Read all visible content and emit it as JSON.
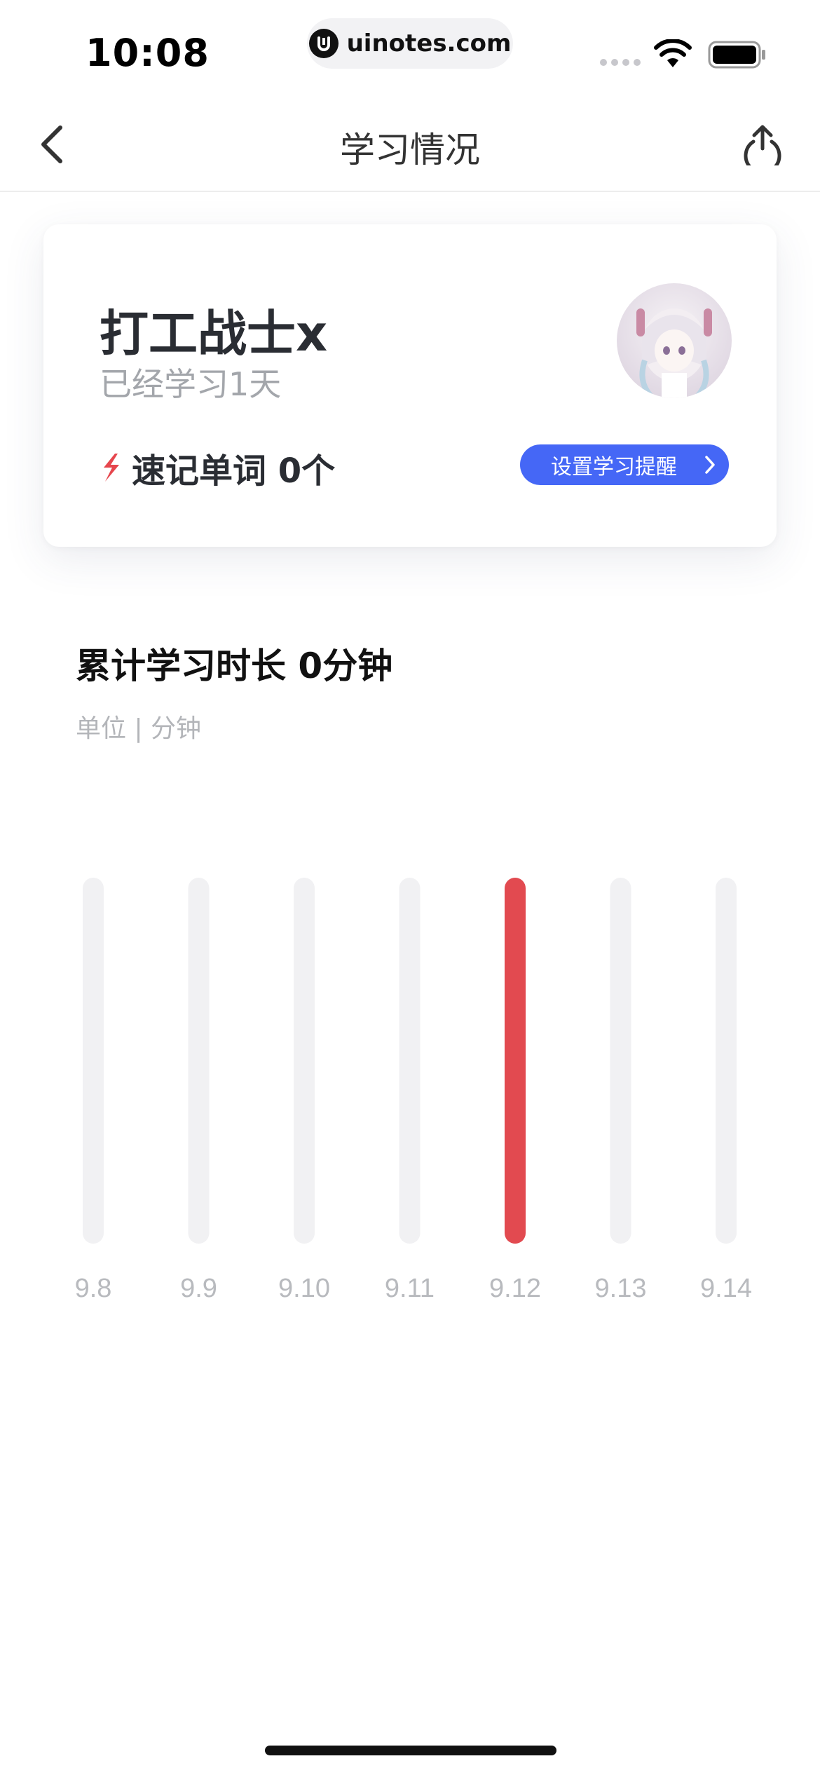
{
  "status_bar": {
    "time": "10:08",
    "url": "uinotes.com"
  },
  "nav": {
    "title": "学习情况",
    "back_icon": "chevron-left-icon",
    "share_icon": "share-icon"
  },
  "profile": {
    "name": "打工战士x",
    "days_studied": "已经学习1天",
    "words_label": "速记单词 0个",
    "reminder_button": "设置学习提醒",
    "accent_color": "#e6464d",
    "button_color": "#4567f6"
  },
  "chart_section": {
    "title": "累计学习时长 0分钟",
    "unit": "单位 | 分钟"
  },
  "chart_data": {
    "type": "bar",
    "categories": [
      "9.8",
      "9.9",
      "9.10",
      "9.11",
      "9.12",
      "9.13",
      "9.14"
    ],
    "values": [
      0,
      0,
      0,
      0,
      0,
      0,
      0
    ],
    "highlight_index": 4,
    "track_color": "#f1f1f3",
    "highlight_color": "#e24a50",
    "label_color": "#b8babe"
  }
}
